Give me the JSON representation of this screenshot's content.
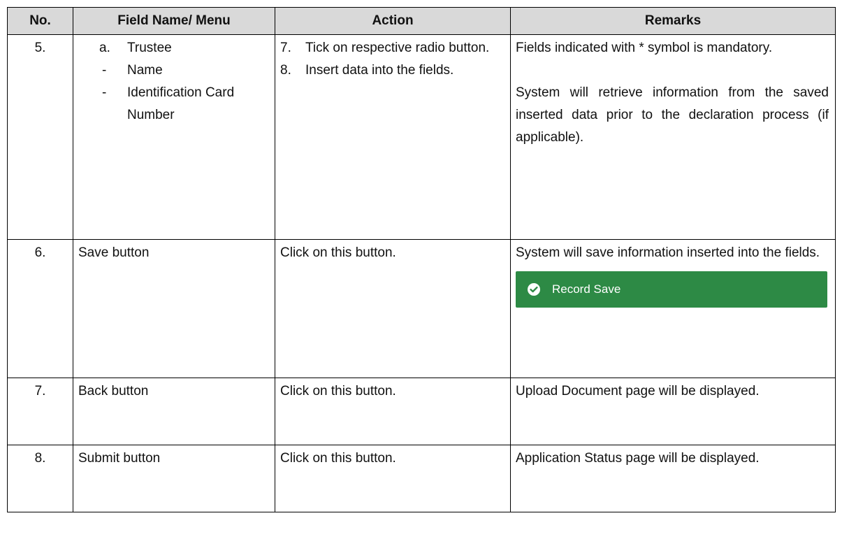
{
  "headers": {
    "no": "No.",
    "field": "Field Name/ Menu",
    "action": "Action",
    "remarks": "Remarks"
  },
  "rows": [
    {
      "no": "5.",
      "field": {
        "alpha_marker": "a.",
        "alpha_text": "Trustee",
        "items": [
          "Name",
          "Identification Card Number"
        ],
        "item_marker": "-"
      },
      "actions": [
        {
          "marker": "7.",
          "text": "Tick on respective radio button."
        },
        {
          "marker": "8.",
          "text": "Insert data into the fields."
        }
      ],
      "remarks": [
        "Fields indicated with * symbol is mandatory.",
        "System will retrieve information from the saved inserted data prior to the declaration process (if applicable)."
      ]
    },
    {
      "no": "6.",
      "field": "Save button",
      "action": "Click on this button.",
      "remark": "System will save information inserted into the fields.",
      "toast": {
        "label": "Record Save",
        "color": "#2d8a45",
        "icon": "check-circle-icon"
      }
    },
    {
      "no": "7.",
      "field": "Back button",
      "action": "Click on this button.",
      "remark": "Upload Document page will be displayed."
    },
    {
      "no": "8.",
      "field": "Submit button",
      "action": "Click on this button.",
      "remark": "Application Status page will be displayed."
    }
  ]
}
